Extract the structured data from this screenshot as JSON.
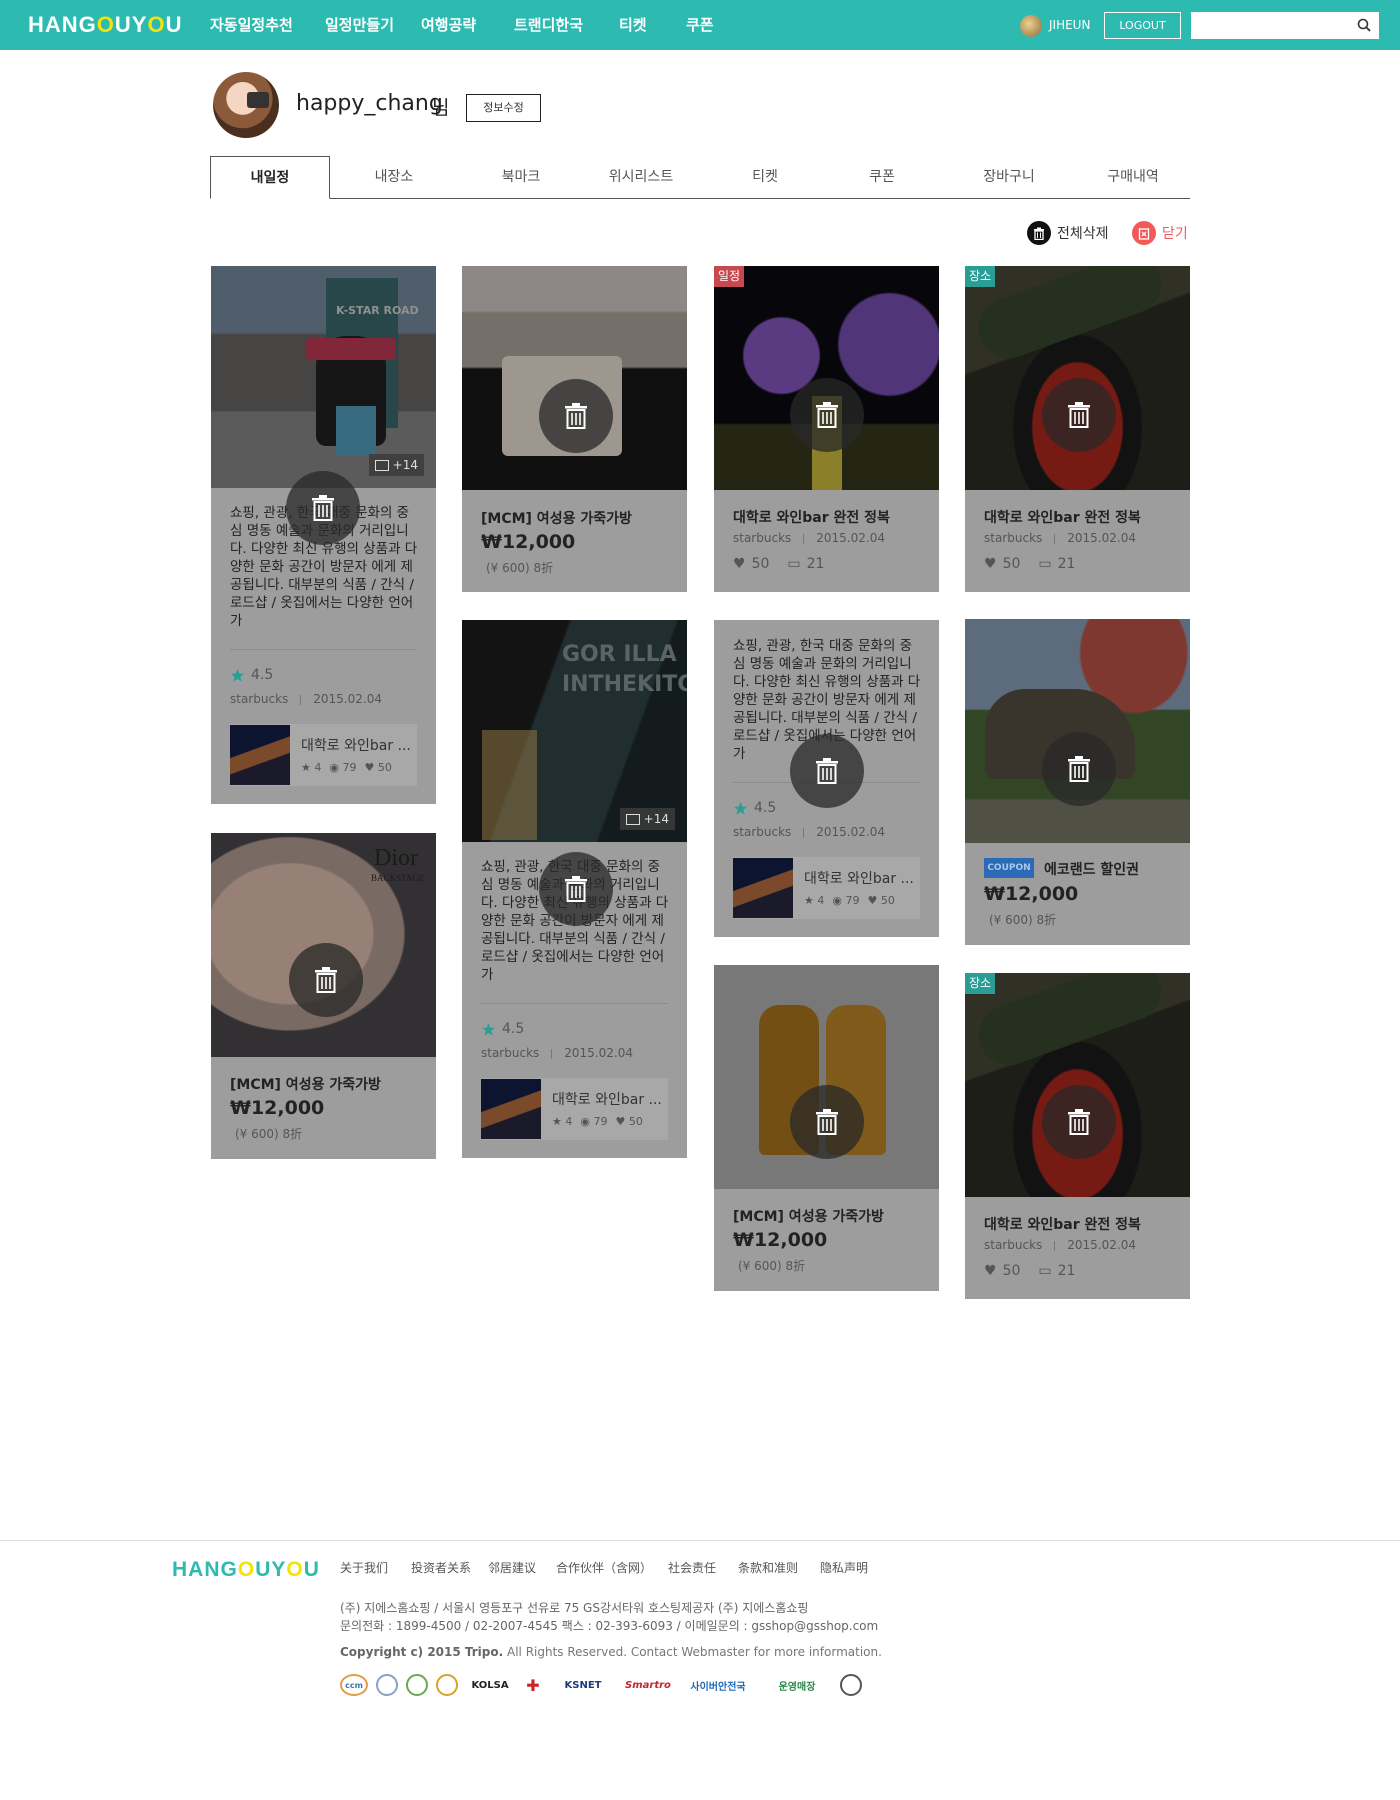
{
  "header": {
    "logo": [
      "HANG",
      "O",
      "U",
      "Y",
      "O",
      "U"
    ],
    "nav": [
      "자동일정추천",
      "일정만들기",
      "여행공략",
      "트랜디한국",
      "티켓",
      "쿠폰"
    ],
    "user_name": "JIHEUN",
    "logout_label": "LOGOUT",
    "search_placeholder": ""
  },
  "profile": {
    "name": "happy_chang",
    "suffix": "님",
    "edit_label": "정보수정"
  },
  "tabs": [
    "내일정",
    "내장소",
    "북마크",
    "위시리스트",
    "티켓",
    "쿠폰",
    "장바구니",
    "구매내역"
  ],
  "actions": {
    "delete_all": "전체삭제",
    "close": "닫기"
  },
  "cards": {
    "c1": {
      "photo_count": "+14",
      "desc": "쇼핑, 관광, 한국 대중 문화의 중심 명동 예술과 문화의 거리입니다. 다양한 최신 유행의 상품과 다양한 문화 공간이 방문자 에게 제공됩니다. 대부분의 식품 / 간식 / 로드샵 / 옷집에서는 다양한 언어가",
      "rating": "4.5",
      "author": "starbucks",
      "date": "2015.02.04",
      "mini": {
        "title": "대학로 와인bar ...",
        "stars": "4",
        "views": "79",
        "likes": "50"
      }
    },
    "c2": {
      "title": "[MCM] 여성용 가죽가방",
      "price": "₩12,000",
      "sub": "(¥ 600) 8折"
    },
    "c3": {
      "badge": "일정",
      "title": "대학로 와인bar 완전 정복",
      "author": "starbucks",
      "date": "2015.02.04",
      "likes": "50",
      "comments": "21"
    },
    "c4": {
      "badge": "장소",
      "title": "대학로 와인bar 완전 정복",
      "author": "starbucks",
      "date": "2015.02.04",
      "likes": "50",
      "comments": "21"
    },
    "c5": {
      "title": "[MCM] 여성용 가죽가방",
      "price": "₩12,000",
      "sub": "(¥ 600) 8折",
      "brand_text": "Dior",
      "brand_sub": "BACKSTAGE"
    },
    "c6": {
      "photo_count": "+14",
      "sign_text": "GOR ILLA INTHEKITC",
      "desc": "쇼핑, 관광, 한국 대중 문화의 중심 명동 예술과 문화의 거리입니다. 다양한 최신 유행의 상품과 다양한 문화 공간이 방문자 에게 제공됩니다. 대부분의 식품 / 간식 / 로드샵 / 옷집에서는 다양한 언어가",
      "rating": "4.5",
      "author": "starbucks",
      "date": "2015.02.04",
      "mini": {
        "title": "대학로 와인bar ...",
        "stars": "4",
        "views": "79",
        "likes": "50"
      }
    },
    "c7": {
      "desc": "쇼핑, 관광, 한국 대중 문화의 중심 명동 예술과 문화의 거리입니다. 다양한 최신 유행의 상품과 다양한 문화 공간이 방문자 에게 제공됩니다. 대부분의 식품 / 간식 / 로드샵 / 옷집에서는 다양한 언어가",
      "rating": "4.5",
      "author": "starbucks",
      "date": "2015.02.04",
      "mini": {
        "title": "대학로 와인bar ...",
        "stars": "4",
        "views": "79",
        "likes": "50"
      }
    },
    "c8": {
      "coupon_tag": "COUPON",
      "title": "에코랜드 할인권",
      "price": "₩12,000",
      "sub": "(¥ 600) 8折"
    },
    "c9": {
      "title": "[MCM] 여성용 가죽가방",
      "price": "₩12,000",
      "sub": "(¥ 600) 8折"
    },
    "c10": {
      "badge": "장소",
      "title": "대학로 와인bar 완전 정복",
      "author": "starbucks",
      "date": "2015.02.04",
      "likes": "50",
      "comments": "21"
    }
  },
  "footer": {
    "logo": [
      "HANG",
      "O",
      "U",
      "Y",
      "O",
      "U"
    ],
    "links": [
      "关于我们",
      "投资者关系",
      "邻居建议",
      "合作伙伴（含网）",
      "社会责任",
      "条款和准则",
      "隐私声明"
    ],
    "info_line1": "(주) 지에스홈쇼핑  / 서울시 영등포구 선유로 75 GS강서타워 호스팅제공자 (주) 지에스홈쇼핑",
    "info_line2": "문의전화 : 1899-4500 / 02-2007-4545 팩스 : 02-393-6093 / 이메일문의 : gsshop@gsshop.com",
    "copyright_bold": "Copyright c) 2015 Tripo.",
    "copyright_rest": " All Rights Reserved. Contact Webmaster for more information.",
    "certs": [
      "ccm",
      "",
      "",
      "",
      "KOLSA",
      "",
      "KSNET",
      "Smartro",
      "사이버안전국",
      "운영매장",
      ""
    ]
  },
  "colors": {
    "brand": "#2dbab1",
    "accent_yellow": "#f3e30b",
    "close_red": "#f25a5a",
    "badge_teal": "#2a9d95",
    "badge_red": "#c8484f",
    "rating_star": "#2a9d95"
  }
}
